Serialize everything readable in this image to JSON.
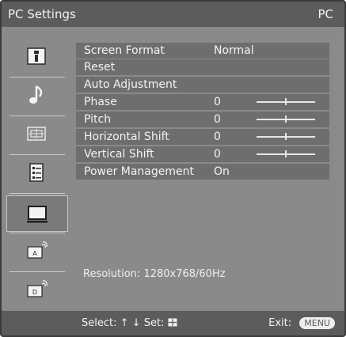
{
  "header": {
    "title": "PC Settings",
    "source": "PC"
  },
  "sidebar": {
    "items": [
      {
        "icon": "picture-settings-icon",
        "active": false
      },
      {
        "icon": "music-note-icon",
        "active": false
      },
      {
        "icon": "screen-adjust-icon",
        "active": false
      },
      {
        "icon": "list-settings-icon",
        "active": false
      },
      {
        "icon": "pc-monitor-icon",
        "active": true
      },
      {
        "icon": "analog-antenna-icon",
        "active": false
      },
      {
        "icon": "digital-antenna-icon",
        "active": false
      }
    ]
  },
  "settings": {
    "rows": [
      {
        "label": "Screen Format",
        "value": "Normal",
        "slider": null
      },
      {
        "label": "Reset",
        "value": "",
        "slider": null
      },
      {
        "label": "Auto Adjustment",
        "value": "",
        "slider": null
      },
      {
        "label": "Phase",
        "value": "0",
        "slider": 0.5
      },
      {
        "label": "Pitch",
        "value": "0",
        "slider": 0.5
      },
      {
        "label": "Horizontal Shift",
        "value": "0",
        "slider": 0.5
      },
      {
        "label": "Vertical Shift",
        "value": "0",
        "slider": 0.5
      },
      {
        "label": "Power Management",
        "value": "On",
        "slider": null
      }
    ]
  },
  "status": {
    "resolution": "Resolution: 1280x768/60Hz"
  },
  "footer": {
    "select_label": "Select:",
    "select_arrows": "↑ ↓",
    "set_label": "Set:",
    "exit_label": "Exit:",
    "exit_button": "MENU"
  }
}
